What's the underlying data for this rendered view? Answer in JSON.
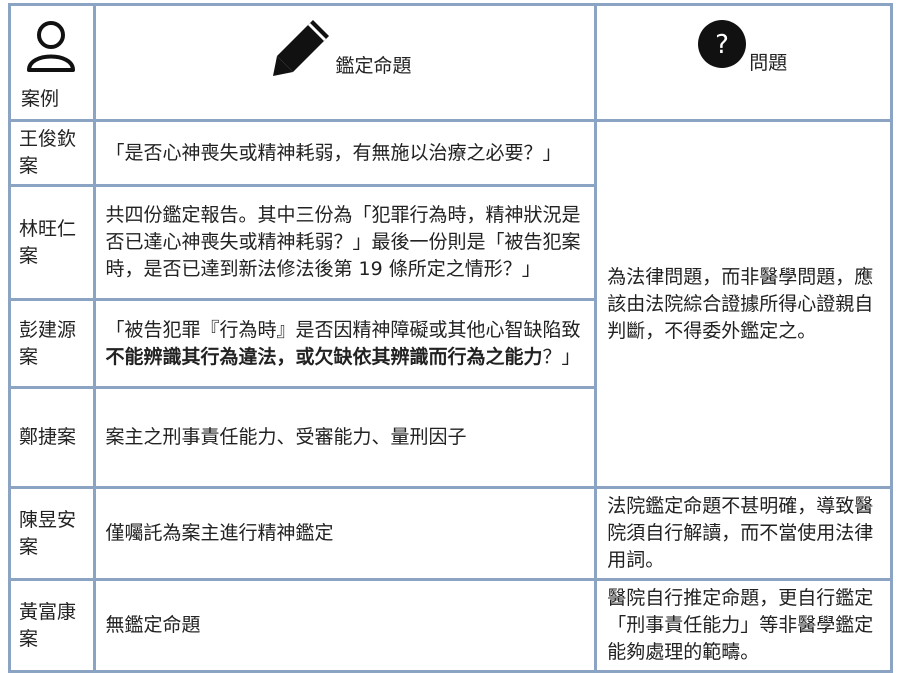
{
  "header": {
    "case_label": "案例",
    "topic_label": "鑑定命題",
    "issue_label": "問題",
    "icons": [
      "person-icon",
      "pencil-icon",
      "question-icon"
    ]
  },
  "rows": [
    {
      "case": "王俊欽案",
      "topic": "「是否心神喪失或精神耗弱，有無施以治療之必要？」"
    },
    {
      "case": "林旺仁案",
      "topic": "共四份鑑定報告。其中三份為「犯罪行為時，精神狀況是否已達心神喪失或精神耗弱？」最後一份則是「被告犯案時，是否已達到新法修法後第 19 條所定之情形？」"
    },
    {
      "case": "彭建源案",
      "topic_pre": "「被告犯罪『行為時』是否因精神障礙或其他心智缺陷致",
      "topic_bold": "不能辨識其行為違法，或欠缺依其辨識而行為之能力",
      "topic_post": "？」"
    },
    {
      "case": "鄭捷案",
      "topic": "案主之刑事責任能力、受審能力、量刑因子"
    },
    {
      "case": "陳昱安案",
      "topic": "僅囑託為案主進行精神鑑定"
    },
    {
      "case": "黃富康案",
      "topic": "無鑑定命題"
    }
  ],
  "issues": {
    "merged": "為法律問題，而非醫學問題，應該由法院綜合證據所得心證親自判斷，不得委外鑑定之。",
    "chen": "法院鑑定命題不甚明確，導致醫院須自行解讀，而不當使用法律用詞。",
    "huang": "醫院自行推定命題，更自行鑑定「刑事責任能力」等非醫學鑑定能夠處理的範疇。"
  }
}
